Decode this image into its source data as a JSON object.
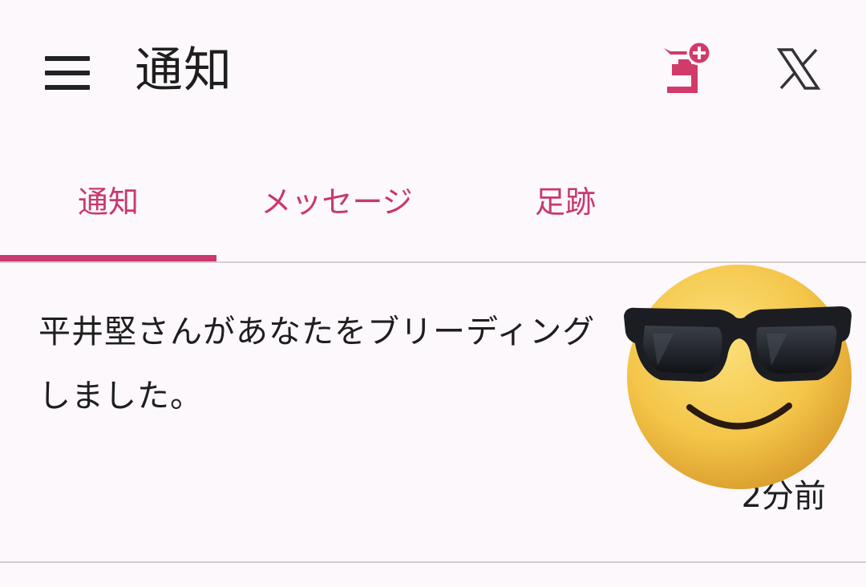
{
  "header": {
    "title": "通知",
    "menu_icon": "hamburger-menu-icon",
    "app_icon": "app-plus-icon",
    "x_icon": "x-logo-icon"
  },
  "tabs": [
    {
      "label": "通知",
      "active": true
    },
    {
      "label": "メッセージ",
      "active": false
    },
    {
      "label": "足跡",
      "active": false
    }
  ],
  "notifications": [
    {
      "text": "平井堅さんがあなたをブリーディングしました。",
      "time": "2分前",
      "avatar_icon": "sunglasses-emoji-icon"
    }
  ],
  "colors": {
    "accent": "#c9386e",
    "background": "#fcf8fc",
    "text": "#1e1e1e",
    "divider": "#d6cccc"
  }
}
